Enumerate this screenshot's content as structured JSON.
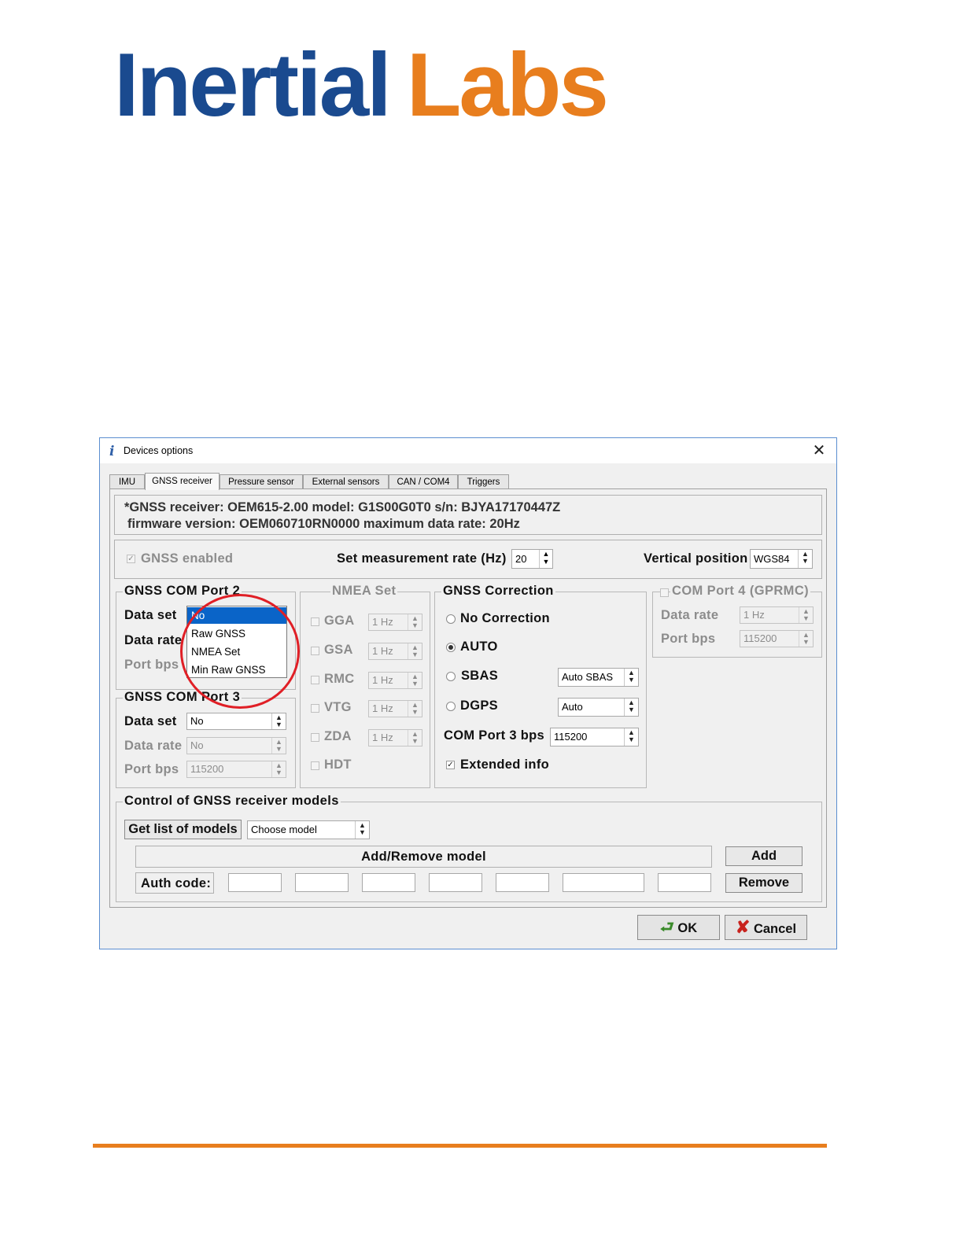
{
  "logo": {
    "part1": "Inertial",
    "part2": "Labs"
  },
  "colors": {
    "logo_blue": "#1a4a8f",
    "logo_orange": "#e87e1e",
    "selection": "#0a64c8",
    "highlight": "#e01f26"
  },
  "dialog": {
    "title": "Devices options",
    "icon": "info-i-icon",
    "tabs": [
      "IMU",
      "GNSS receiver",
      "Pressure sensor",
      "External sensors",
      "CAN / COM4",
      "Triggers"
    ],
    "active_tab": "GNSS receiver",
    "info_line1": "*GNSS receiver: OEM615-2.00 model: G1S00G0T0 s/n: BJYA17170447Z",
    "info_line2": "firmware version: OEM060710RN0000 maximum data rate: 20Hz",
    "gnss_enabled_label": "GNSS enabled",
    "set_rate_label": "Set measurement rate (Hz)",
    "set_rate_value": "20",
    "vertical_position_label": "Vertical position",
    "vertical_position_value": "WGS84",
    "com2": {
      "title": "GNSS COM Port 2",
      "data_set_label": "Data set",
      "data_rate_label": "Data rate",
      "port_bps_label": "Port bps",
      "dropdown_options": [
        "No",
        "Raw GNSS",
        "NMEA Set",
        "Min Raw GNSS"
      ]
    },
    "com3": {
      "title": "GNSS COM Port 3",
      "data_set_label": "Data set",
      "data_set_value": "No",
      "data_rate_label": "Data rate",
      "data_rate_value": "No",
      "port_bps_label": "Port bps",
      "port_bps_value": "115200"
    },
    "nmea": {
      "title": "NMEA Set",
      "items": [
        {
          "name": "GGA",
          "rate": "1 Hz"
        },
        {
          "name": "GSA",
          "rate": "1 Hz"
        },
        {
          "name": "RMC",
          "rate": "1 Hz"
        },
        {
          "name": "VTG",
          "rate": "1 Hz"
        },
        {
          "name": "ZDA",
          "rate": "1 Hz"
        },
        {
          "name": "HDT",
          "rate": ""
        }
      ]
    },
    "correction": {
      "title": "GNSS Correction",
      "no_correction": "No Correction",
      "auto": "AUTO",
      "sbas": "SBAS",
      "sbas_value": "Auto SBAS",
      "dgps": "DGPS",
      "dgps_value": "Auto",
      "com3_bps_label": "COM Port 3 bps",
      "com3_bps_value": "115200",
      "extended_info": "Extended info"
    },
    "com4": {
      "title": "COM Port 4 (GPRMC)",
      "data_rate_label": "Data rate",
      "data_rate_value": "1 Hz",
      "port_bps_label": "Port bps",
      "port_bps_value": "115200"
    },
    "models": {
      "title": "Control of GNSS receiver models",
      "get_list": "Get list of models",
      "choose_model": "Choose model",
      "add_remove": "Add/Remove model",
      "add": "Add",
      "auth_code": "Auth code:",
      "remove": "Remove"
    },
    "ok": "OK",
    "cancel": "Cancel"
  }
}
